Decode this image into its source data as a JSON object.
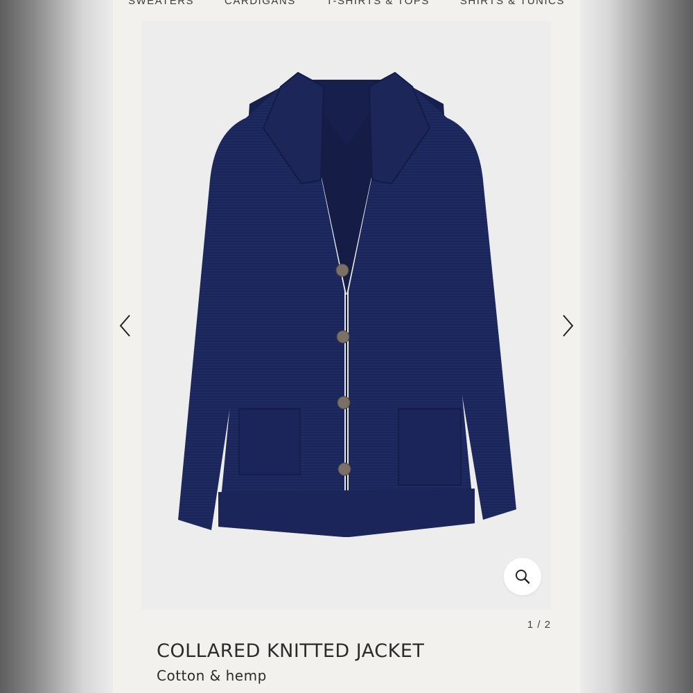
{
  "nav": {
    "items": [
      {
        "label": "SWEATERS"
      },
      {
        "label": "CARDIGANS"
      },
      {
        "label": "T-SHIRTS & TOPS"
      },
      {
        "label": "SHIRTS & TUNICS"
      }
    ]
  },
  "gallery": {
    "current": "1",
    "total": "2",
    "counter_text": "1 / 2",
    "image_subject": "navy collared knitted cardigan jacket with four buttons and two patch pockets",
    "prev_icon": "chevron-left-icon",
    "next_icon": "chevron-right-icon",
    "zoom_icon": "magnifier-icon"
  },
  "product": {
    "name": "COLLARED KNITTED JACKET",
    "material": "Cotton & hemp"
  },
  "colors": {
    "garment": "#1f2a63",
    "panel_bg": "#f3f1ee",
    "photo_bg": "#ededed",
    "text": "#2b2b2b"
  }
}
